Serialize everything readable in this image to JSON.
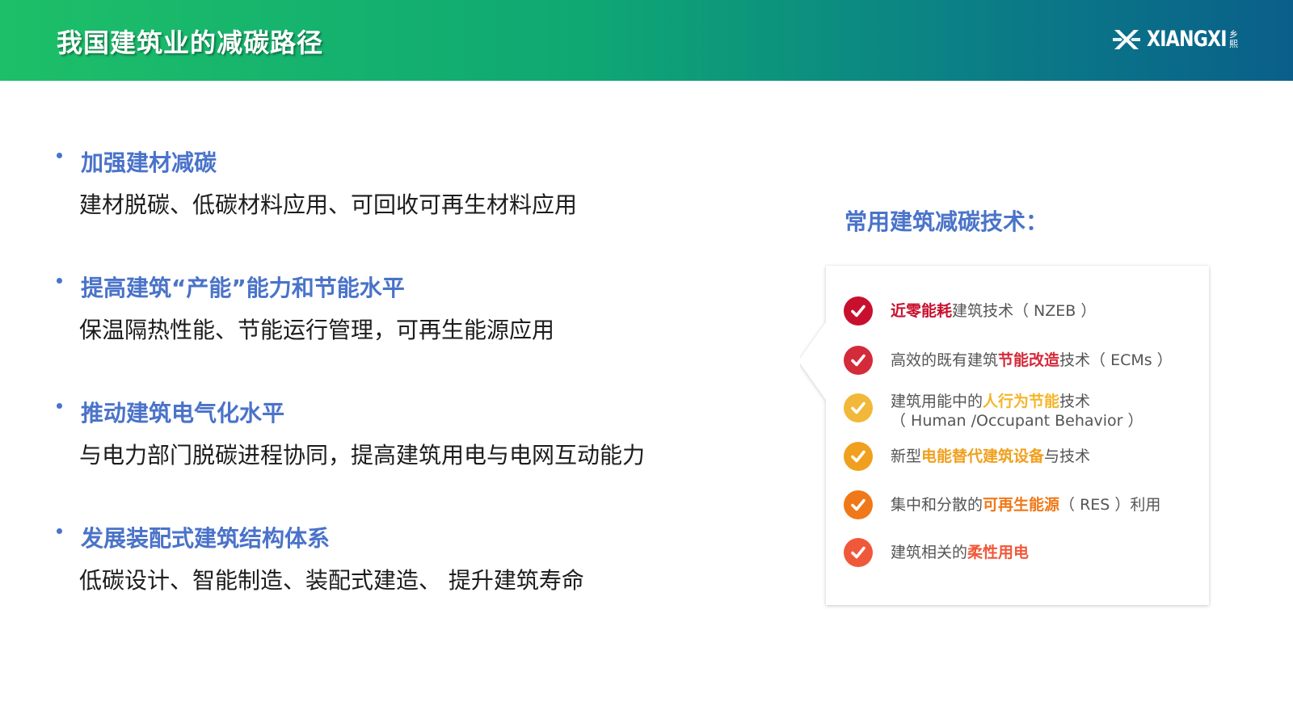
{
  "header": {
    "title": "我国建筑业的减碳路径",
    "brand_name": "XIANGXI",
    "brand_cn_1": "乡",
    "brand_cn_2": "熙"
  },
  "points": [
    {
      "heading": "加强建材减碳",
      "desc": "建材脱碳、低碳材料应用、可回收可再生材料应用"
    },
    {
      "heading": "提高建筑“产能”能力和节能水平",
      "desc": "保温隔热性能、节能运行管理，可再生能源应用"
    },
    {
      "heading": "推动建筑电气化水平",
      "desc": "与电力部门脱碳进程协同，提高建筑用电与电网互动能力"
    },
    {
      "heading": "发展装配式建筑结构体系",
      "desc": "低碳设计、智能制造、装配式建造、 提升建筑寿命"
    }
  ],
  "side": {
    "title": "常用建筑减碳技术：",
    "items": [
      {
        "pre": "",
        "hl": "近零能耗",
        "post": "建筑技术（ NZEB ）",
        "line2": "",
        "check_color": "#c8102e",
        "hl_color": "#c8102e"
      },
      {
        "pre": "高效的既有建筑",
        "hl": "节能改造",
        "post": "技术（ ECMs ）",
        "line2": "",
        "check_color": "#d42b3a",
        "hl_color": "#d42b3a"
      },
      {
        "pre": "建筑用能中的",
        "hl": "人行为节能",
        "post": "技术",
        "line2": "（ Human /Occupant Behavior ）",
        "check_color": "#f2b83a",
        "hl_color": "#f5b52b"
      },
      {
        "pre": "新型",
        "hl": "电能替代建筑设备",
        "post": "与技术",
        "line2": "",
        "check_color": "#f0a01e",
        "hl_color": "#f0a01e"
      },
      {
        "pre": "集中和分散的",
        "hl": "可再生能源",
        "post": "（ RES ）利用",
        "line2": "",
        "check_color": "#f07818",
        "hl_color": "#f07818"
      },
      {
        "pre": "建筑相关的",
        "hl": "柔性用电",
        "post": "",
        "line2": "",
        "check_color": "#f0583a",
        "hl_color": "#f0583a"
      }
    ]
  }
}
